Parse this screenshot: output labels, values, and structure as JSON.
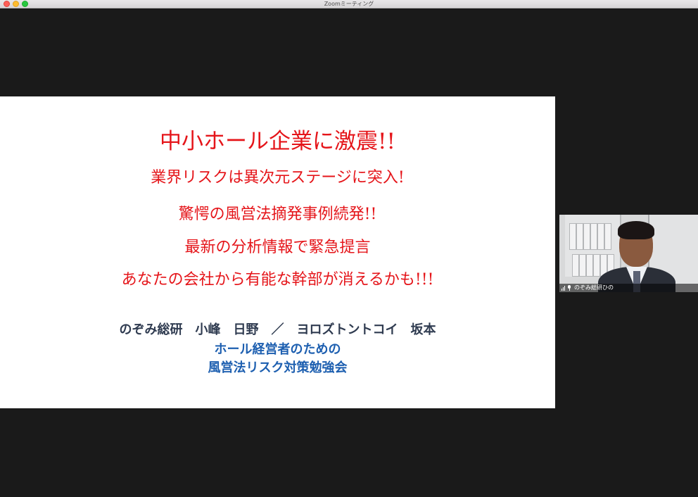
{
  "window": {
    "title": "Zoomミーティング"
  },
  "slide": {
    "headline": "中小ホール企業に激震!!",
    "lines": [
      "業界リスクは異次元ステージに突入!",
      "驚愕の風営法摘発事例続発!!",
      "最新の分析情報で緊急提言",
      "あなたの会社から有能な幹部が消えるかも!!!"
    ],
    "presenters": "のぞみ総研　小峰　日野　／　ヨロズトントコイ　坂本",
    "subtitle_lines": [
      "ホール経営者のための",
      "風営法リスク対策勉強会"
    ]
  },
  "participant": {
    "name": "のぞみ総研ひの",
    "icons": [
      "signal-bars-icon",
      "microphone-icon"
    ]
  },
  "colors": {
    "headline": "#e5151a",
    "presenters": "#2f3b50",
    "subtitle": "#1d5fb0",
    "background": "#1a1a1a"
  }
}
